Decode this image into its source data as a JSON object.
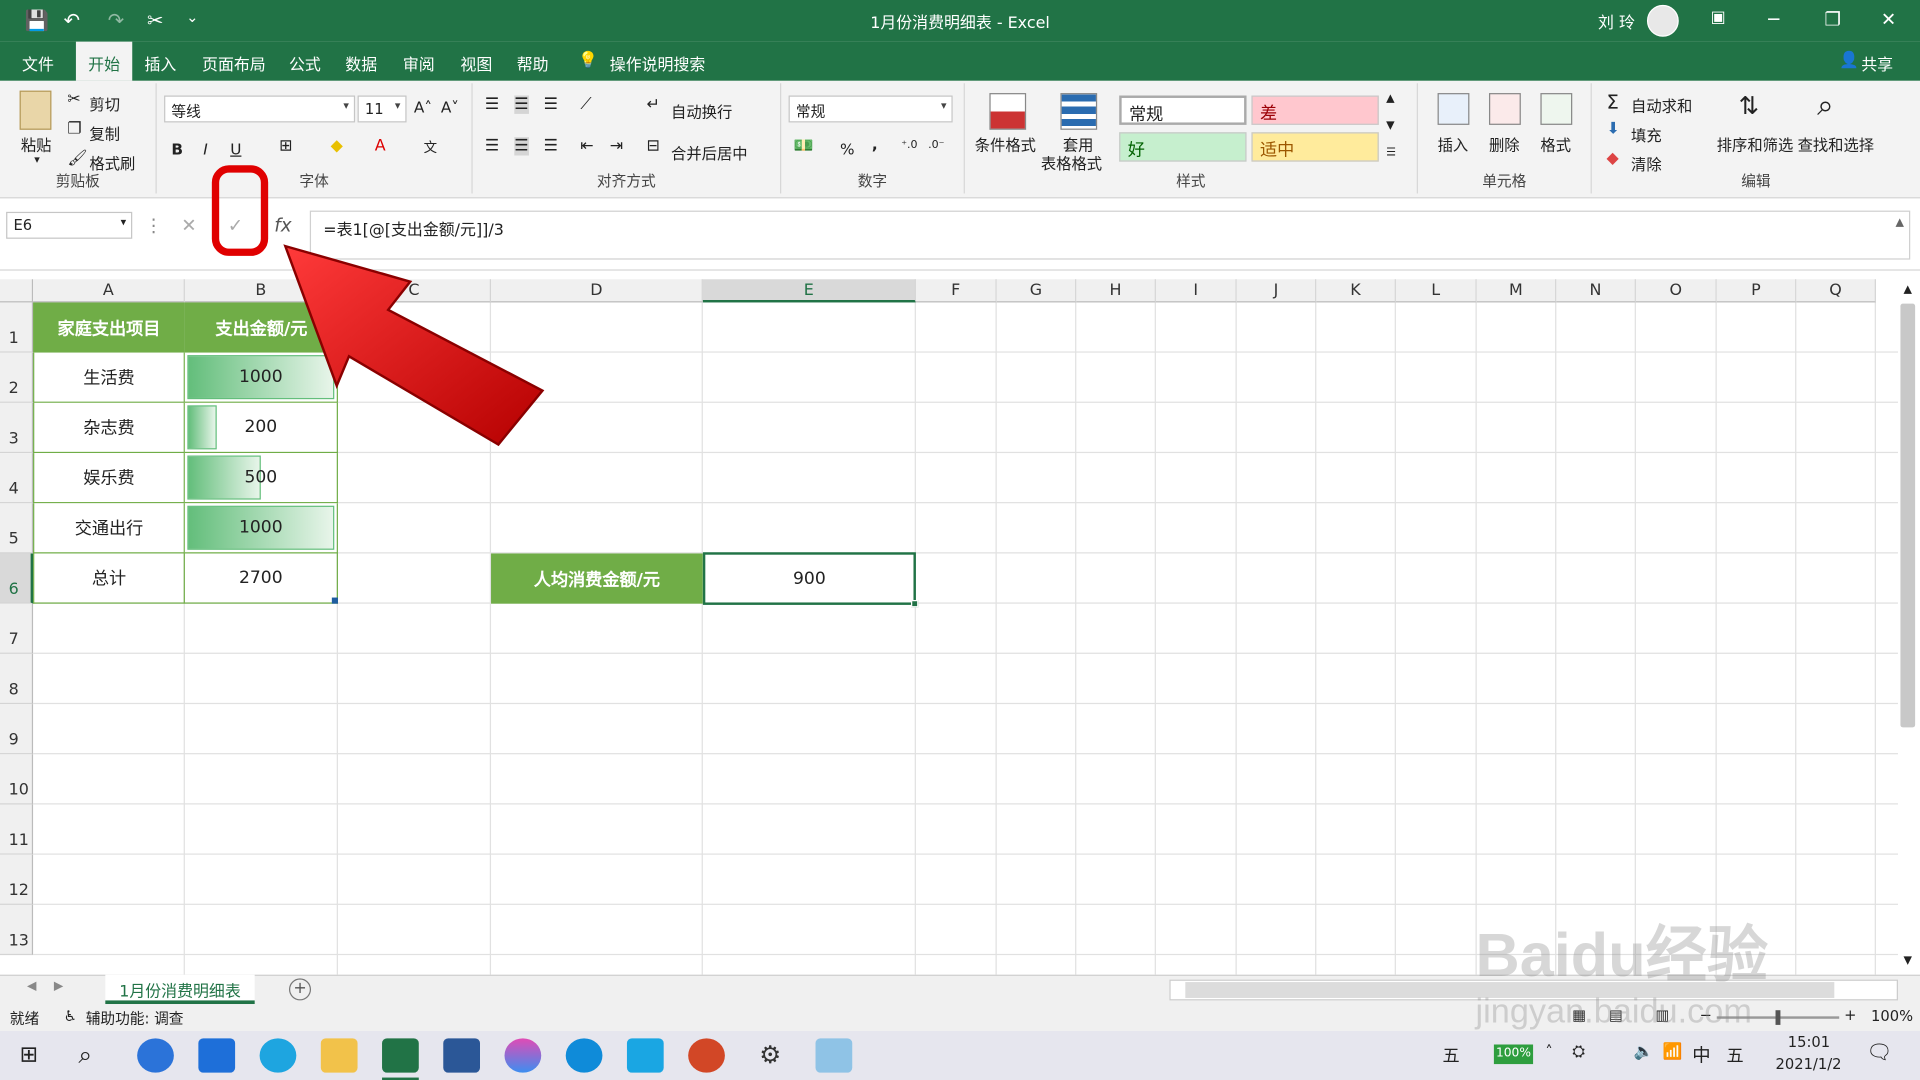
{
  "titlebar": {
    "title": "1月份消费明细表  -  Excel",
    "user": "刘 玲",
    "qa_save": "💾",
    "qa_undo": "↶",
    "qa_redo": "↷",
    "qa_cut": "✂",
    "qa_more": "⌄"
  },
  "tabs": [
    "文件",
    "开始",
    "插入",
    "页面布局",
    "公式",
    "数据",
    "审阅",
    "视图",
    "帮助",
    "操作说明搜索"
  ],
  "share": "共享",
  "ribbon": {
    "clipboard": {
      "paste": "粘贴",
      "cut": "剪切",
      "copy": "复制",
      "painter": "格式刷",
      "label": "剪贴板"
    },
    "font": {
      "name": "等线",
      "size": "11",
      "label": "字体",
      "bold": "B",
      "italic": "I",
      "underline": "U",
      "grow": "A˄",
      "shrink": "A˅"
    },
    "align": {
      "wrap": "自动换行",
      "merge": "合并后居中",
      "label": "对齐方式"
    },
    "number": {
      "format": "常规",
      "label": "数字",
      "percent": "%",
      "comma": ","
    },
    "styles": {
      "cond": "条件格式",
      "table1": "套用",
      "table2": "表格格式",
      "normal": "常规",
      "bad": "差",
      "good": "好",
      "neutral": "适中",
      "label": "样式"
    },
    "cells": {
      "insert": "插入",
      "delete": "删除",
      "format": "格式",
      "label": "单元格"
    },
    "edit": {
      "autosum": "自动求和",
      "fill": "填充",
      "clear": "清除",
      "sort": "排序和筛选",
      "find": "查找和选择",
      "label": "编辑"
    }
  },
  "formula_bar": {
    "name_box": "E6",
    "formula": "=表1[@[支出金额/元]]/3",
    "fx": "fx",
    "cancel": "✕",
    "enter": "✓"
  },
  "columns": [
    "A",
    "B",
    "C",
    "D",
    "E",
    "F",
    "G",
    "H",
    "I",
    "J",
    "K",
    "L",
    "M",
    "N",
    "O",
    "P",
    "Q"
  ],
  "rows": [
    "1",
    "2",
    "3",
    "4",
    "5",
    "6",
    "7",
    "8",
    "9",
    "10",
    "11",
    "12",
    "13"
  ],
  "table": {
    "headers": [
      "家庭支出项目",
      "支出金额/元"
    ],
    "rows": [
      {
        "item": "生活费",
        "amount": "1000",
        "bar": 1.0
      },
      {
        "item": "杂志费",
        "amount": "200",
        "bar": 0.2
      },
      {
        "item": "娱乐费",
        "amount": "500",
        "bar": 0.5
      },
      {
        "item": "交通出行",
        "amount": "1000",
        "bar": 1.0
      }
    ],
    "total_label": "总计",
    "total_value": "2700"
  },
  "avg": {
    "label": "人均消费金额/元",
    "value": "900"
  },
  "sheet_tab": "1月份消费明细表",
  "status": {
    "ready": "就绪",
    "accessibility": "辅助功能: 调查",
    "zoom": "100%"
  },
  "taskbar": {
    "time": "15:01",
    "date": "2021/1/2",
    "ime": "中",
    "battery": "100%",
    "day1": "五",
    "day2": "五"
  },
  "watermark": "Baidu经验",
  "watermark_url": "jingyan.baidu.com",
  "colors": {
    "excel_green": "#217346",
    "table_green": "#70ad47",
    "highlight_red": "#e00000"
  }
}
